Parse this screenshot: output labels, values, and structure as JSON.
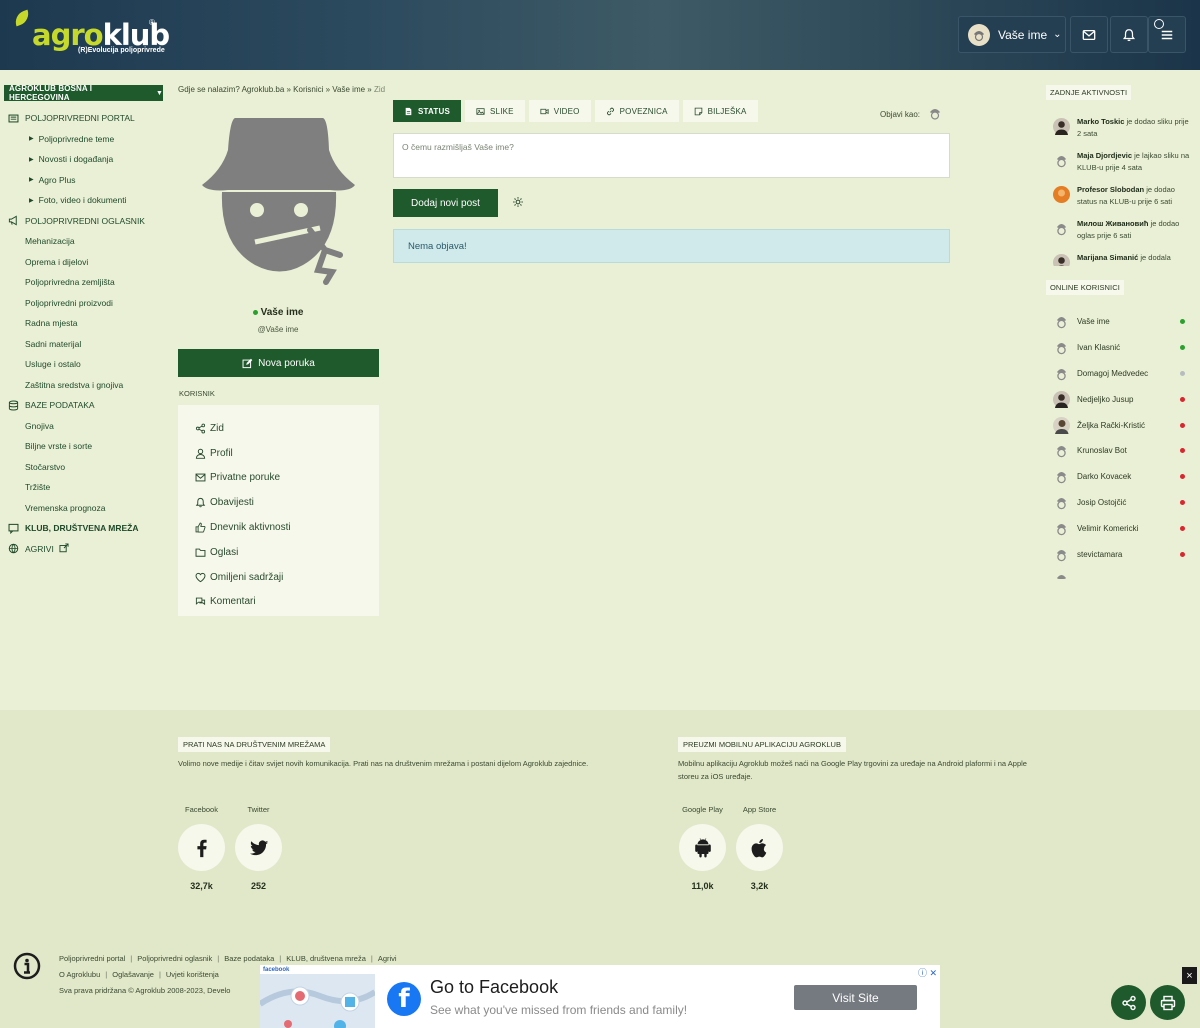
{
  "header": {
    "logo_part1": "agro",
    "logo_part2": "klub",
    "logo_reg": "®",
    "logo_tagline": "(R)Evolucija poljoprivrede",
    "user_label": "Vaše ime"
  },
  "sidebar": {
    "region": "AGROKLUB BOSNA I HERCEGOVINA",
    "items": [
      {
        "type": "sec",
        "label": "POLJOPRIVREDNI PORTAL",
        "icon": "newspaper-icon"
      },
      {
        "type": "sub",
        "label": "Poljoprivredne teme"
      },
      {
        "type": "sub",
        "label": "Novosti i događanja"
      },
      {
        "type": "sub",
        "label": "Agro Plus"
      },
      {
        "type": "sub",
        "label": "Foto, video i dokumenti"
      },
      {
        "type": "sec",
        "label": "POLJOPRIVREDNI OGLASNIK",
        "icon": "megaphone-icon"
      },
      {
        "type": "item",
        "label": "Mehanizacija"
      },
      {
        "type": "item",
        "label": "Oprema i dijelovi"
      },
      {
        "type": "item",
        "label": "Poljoprivredna zemljišta"
      },
      {
        "type": "item",
        "label": "Poljoprivredni proizvodi"
      },
      {
        "type": "item",
        "label": "Radna mjesta"
      },
      {
        "type": "item",
        "label": "Sadni materijal"
      },
      {
        "type": "item",
        "label": "Usluge i ostalo"
      },
      {
        "type": "item",
        "label": "Zaštitna sredstva i gnojiva"
      },
      {
        "type": "sec",
        "label": "BAZE PODATAKA",
        "icon": "database-icon"
      },
      {
        "type": "item",
        "label": "Gnojiva"
      },
      {
        "type": "item",
        "label": "Biljne vrste i sorte"
      },
      {
        "type": "item",
        "label": "Stočarstvo"
      },
      {
        "type": "item",
        "label": "Tržište"
      },
      {
        "type": "item",
        "label": "Vremenska prognoza"
      },
      {
        "type": "sec",
        "label": "KLUB, DRUŠTVENA MREŽA",
        "icon": "chat-icon",
        "bold": true
      },
      {
        "type": "sec",
        "label": "AGRIVI",
        "icon": "globe-icon",
        "ext": true
      }
    ]
  },
  "breadcrumb": {
    "prefix": "Gdje se nalazim?",
    "trail": "Agroklub.ba » Korisnici » Vaše ime »",
    "current": "Zid"
  },
  "profile": {
    "name": "Vaše ime",
    "handle": "@Vaše ime",
    "new_message": "Nova poruka",
    "section_label": "KORISNIK",
    "menu": [
      {
        "label": "Zid",
        "icon": "share-nodes-icon"
      },
      {
        "label": "Profil",
        "icon": "user-icon"
      },
      {
        "label": "Privatne poruke",
        "icon": "envelope-icon"
      },
      {
        "label": "Obavijesti",
        "icon": "bell-icon"
      },
      {
        "label": "Dnevnik aktivnosti",
        "icon": "thumbs-up-icon"
      },
      {
        "label": "Oglasi",
        "icon": "folder-icon"
      },
      {
        "label": "Omiljeni sadržaji",
        "icon": "heart-icon"
      },
      {
        "label": "Komentari",
        "icon": "comments-icon"
      }
    ]
  },
  "composer": {
    "tabs": [
      {
        "label": "STATUS",
        "icon": "file-icon",
        "active": true
      },
      {
        "label": "SLIKE",
        "icon": "image-icon"
      },
      {
        "label": "VIDEO",
        "icon": "video-icon"
      },
      {
        "label": "POVEZNICA",
        "icon": "link-icon"
      },
      {
        "label": "BILJEŠKA",
        "icon": "note-icon"
      }
    ],
    "post_as": "Objavi kao:",
    "placeholder": "O čemu razmišljaš Vaše ime?",
    "add_post": "Dodaj novi post",
    "empty": "Nema objava!"
  },
  "right": {
    "activity_title": "ZADNJE AKTIVNOSTI",
    "activities": [
      {
        "name": "Marko Toskic",
        "text": "je dodao sliku",
        "time": "prije 2 sata",
        "avatar": "photo"
      },
      {
        "name": "Maja Djordjevic",
        "text": "je lajkao sliku na KLUB-u",
        "time": "prije 4 sata",
        "avatar": "default"
      },
      {
        "name": "Profesor Slobodan",
        "text": "je dodao status na KLUB-u",
        "time": "prije 6 sati",
        "avatar": "orange"
      },
      {
        "name": "Милош Живановић",
        "text": "je dodao oglas",
        "time": "prije 6 sati",
        "avatar": "default"
      },
      {
        "name": "Marijana Simanić",
        "text": "je dodala",
        "time": "",
        "avatar": "photo"
      }
    ],
    "online_title": "ONLINE KORISNICI",
    "online": [
      {
        "name": "Vaše ime",
        "status": "#2aa12e",
        "avatar": "default"
      },
      {
        "name": "Ivan Klasnić",
        "status": "#2aa12e",
        "avatar": "default"
      },
      {
        "name": "Domagoj Medvedec",
        "status": "#b8bcc0",
        "avatar": "default"
      },
      {
        "name": "Nedjeljko Jusup",
        "status": "#d9262f",
        "avatar": "photo"
      },
      {
        "name": "Željka Rački-Kristić",
        "status": "#d9262f",
        "avatar": "photo2"
      },
      {
        "name": "Krunoslav Bot",
        "status": "#d9262f",
        "avatar": "default"
      },
      {
        "name": "Darko Kovacek",
        "status": "#d9262f",
        "avatar": "default"
      },
      {
        "name": "Josip Ostojčić",
        "status": "#d9262f",
        "avatar": "default"
      },
      {
        "name": "Velimir Komericki",
        "status": "#d9262f",
        "avatar": "default"
      },
      {
        "name": "stevictamara",
        "status": "#d9262f",
        "avatar": "default"
      },
      {
        "name": "",
        "status": "",
        "avatar": "default"
      }
    ]
  },
  "footer": {
    "social_title": "PRATI NAS NA DRUŠTVENIM MREŽAMA",
    "social_desc": "Volimo nove medije i čitav svijet novih komunikacija. Prati nas na društvenim mrežama i postani dijelom Agroklub zajednice.",
    "social": [
      {
        "label": "Facebook",
        "count": "32,7k",
        "icon": "facebook-icon"
      },
      {
        "label": "Twitter",
        "count": "252",
        "icon": "twitter-icon"
      }
    ],
    "app_title": "PREUZMI MOBILNU APLIKACIJU AGROKLUB",
    "app_desc": "Mobilnu aplikaciju Agroklub možeš naći na Google Play trgovini za uređaje na Android plaformi i na Apple storeu za iOS uređaje.",
    "apps": [
      {
        "label": "Google Play",
        "count": "11,0k",
        "icon": "android-icon"
      },
      {
        "label": "App Store",
        "count": "3,2k",
        "icon": "apple-icon"
      }
    ],
    "links_row1": [
      "Poljoprivredni portal",
      "Poljoprivredni oglasnik",
      "Baze podataka",
      "KLUB, društvena mreža",
      "Agrivi"
    ],
    "links_row2": [
      "O Agroklubu",
      "Oglašavanje",
      "Uvjeti korištenja"
    ],
    "copyright": "Sva prava pridržana © Agroklub 2008-2023, Develo"
  },
  "ad": {
    "label": "facebook",
    "title": "Go to Facebook",
    "subtitle": "See what you've missed from friends and family!",
    "button": "Visit Site",
    "close": "×"
  },
  "colors": {
    "brand_green": "#1f5a2c",
    "header_blue": "#1d3950",
    "page_bg": "#eaf0d6",
    "logo_lime": "#c6d92b"
  }
}
